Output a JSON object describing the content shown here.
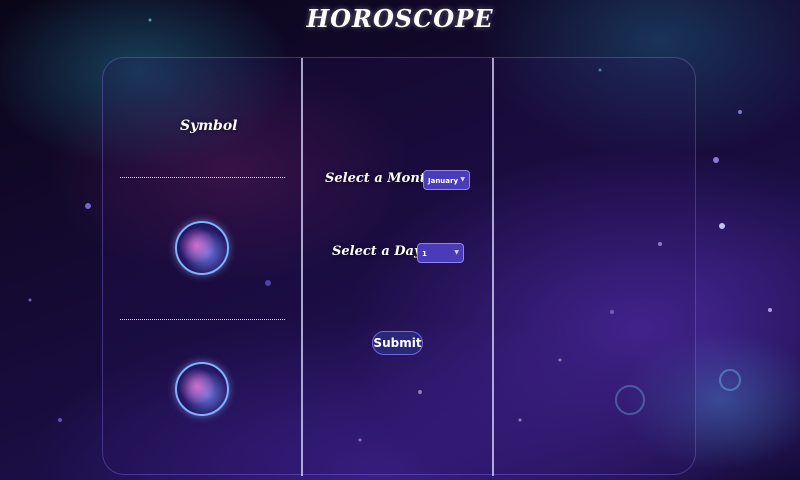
{
  "header": {
    "title": "HOROSCOPE"
  },
  "left_column": {
    "symbol_label": "Symbol"
  },
  "form": {
    "month_label": "Select a Month:",
    "month_value": "January",
    "day_label": "Select a Day:",
    "day_value": "1",
    "submit_label": "Submit"
  },
  "icons": {
    "month_caret": "chevron-down-icon",
    "day_caret": "chevron-down-icon"
  },
  "colors": {
    "accent": "#4a3bb8",
    "submit_bg": "#2a2778",
    "ring": "#7fb2ff"
  }
}
